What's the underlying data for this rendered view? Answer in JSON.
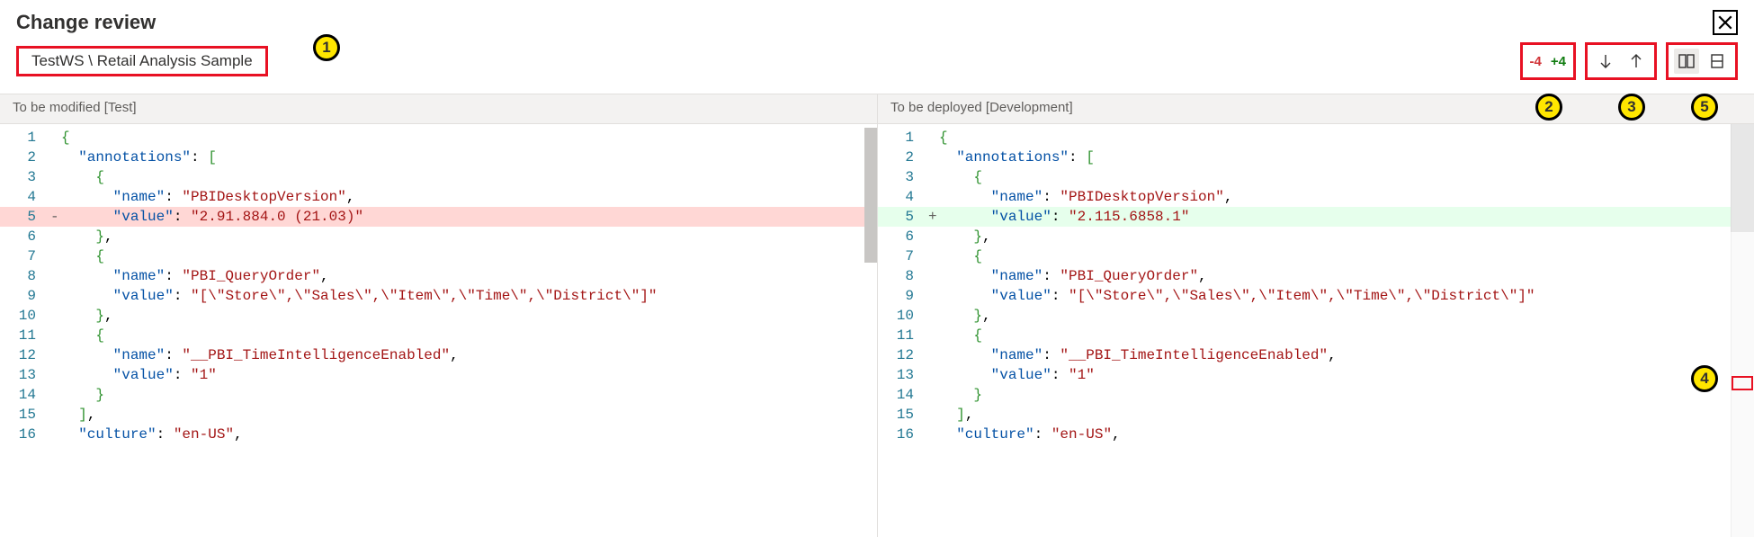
{
  "title": "Change review",
  "breadcrumb": "TestWS \\ Retail Analysis Sample",
  "diff": {
    "removed": "-4",
    "added": "+4"
  },
  "callouts": {
    "c1": "1",
    "c2": "2",
    "c3": "3",
    "c4": "4",
    "c5": "5"
  },
  "panes": {
    "left_header": "To be modified [Test]",
    "right_header": "To be deployed [Development]"
  },
  "left_lines": [
    {
      "n": "1",
      "sign": "",
      "cls": "",
      "tokens": [
        {
          "t": "top",
          "v": "{"
        }
      ]
    },
    {
      "n": "2",
      "sign": "",
      "cls": "",
      "tokens": [
        {
          "t": "sp",
          "v": "  "
        },
        {
          "t": "key",
          "v": "\"annotations\""
        },
        {
          "t": "punc",
          "v": ": "
        },
        {
          "t": "brace",
          "v": "["
        }
      ]
    },
    {
      "n": "3",
      "sign": "",
      "cls": "",
      "tokens": [
        {
          "t": "sp",
          "v": "    "
        },
        {
          "t": "brace",
          "v": "{"
        }
      ]
    },
    {
      "n": "4",
      "sign": "",
      "cls": "",
      "tokens": [
        {
          "t": "sp",
          "v": "      "
        },
        {
          "t": "key",
          "v": "\"name\""
        },
        {
          "t": "punc",
          "v": ": "
        },
        {
          "t": "str",
          "v": "\"PBIDesktopVersion\""
        },
        {
          "t": "comma",
          "v": ","
        }
      ]
    },
    {
      "n": "5",
      "sign": "-",
      "cls": "removed",
      "tokens": [
        {
          "t": "sp",
          "v": "      "
        },
        {
          "t": "key",
          "v": "\"value\""
        },
        {
          "t": "punc",
          "v": ": "
        },
        {
          "t": "str",
          "v": "\"2.91.884.0 (21.03)\""
        }
      ]
    },
    {
      "n": "6",
      "sign": "",
      "cls": "",
      "tokens": [
        {
          "t": "sp",
          "v": "    "
        },
        {
          "t": "brace",
          "v": "}"
        },
        {
          "t": "comma",
          "v": ","
        }
      ]
    },
    {
      "n": "7",
      "sign": "",
      "cls": "",
      "tokens": [
        {
          "t": "sp",
          "v": "    "
        },
        {
          "t": "brace",
          "v": "{"
        }
      ]
    },
    {
      "n": "8",
      "sign": "",
      "cls": "",
      "tokens": [
        {
          "t": "sp",
          "v": "      "
        },
        {
          "t": "key",
          "v": "\"name\""
        },
        {
          "t": "punc",
          "v": ": "
        },
        {
          "t": "str",
          "v": "\"PBI_QueryOrder\""
        },
        {
          "t": "comma",
          "v": ","
        }
      ]
    },
    {
      "n": "9",
      "sign": "",
      "cls": "",
      "tokens": [
        {
          "t": "sp",
          "v": "      "
        },
        {
          "t": "key",
          "v": "\"value\""
        },
        {
          "t": "punc",
          "v": ": "
        },
        {
          "t": "str",
          "v": "\"[\\\"Store\\\",\\\"Sales\\\",\\\"Item\\\",\\\"Time\\\",\\\"District\\\"]\""
        }
      ]
    },
    {
      "n": "10",
      "sign": "",
      "cls": "",
      "tokens": [
        {
          "t": "sp",
          "v": "    "
        },
        {
          "t": "brace",
          "v": "}"
        },
        {
          "t": "comma",
          "v": ","
        }
      ]
    },
    {
      "n": "11",
      "sign": "",
      "cls": "",
      "tokens": [
        {
          "t": "sp",
          "v": "    "
        },
        {
          "t": "brace",
          "v": "{"
        }
      ]
    },
    {
      "n": "12",
      "sign": "",
      "cls": "",
      "tokens": [
        {
          "t": "sp",
          "v": "      "
        },
        {
          "t": "key",
          "v": "\"name\""
        },
        {
          "t": "punc",
          "v": ": "
        },
        {
          "t": "str",
          "v": "\"__PBI_TimeIntelligenceEnabled\""
        },
        {
          "t": "comma",
          "v": ","
        }
      ]
    },
    {
      "n": "13",
      "sign": "",
      "cls": "",
      "tokens": [
        {
          "t": "sp",
          "v": "      "
        },
        {
          "t": "key",
          "v": "\"value\""
        },
        {
          "t": "punc",
          "v": ": "
        },
        {
          "t": "str",
          "v": "\"1\""
        }
      ]
    },
    {
      "n": "14",
      "sign": "",
      "cls": "",
      "tokens": [
        {
          "t": "sp",
          "v": "    "
        },
        {
          "t": "brace",
          "v": "}"
        }
      ]
    },
    {
      "n": "15",
      "sign": "",
      "cls": "",
      "tokens": [
        {
          "t": "sp",
          "v": "  "
        },
        {
          "t": "brace",
          "v": "]"
        },
        {
          "t": "comma",
          "v": ","
        }
      ]
    },
    {
      "n": "16",
      "sign": "",
      "cls": "",
      "tokens": [
        {
          "t": "sp",
          "v": "  "
        },
        {
          "t": "key",
          "v": "\"culture\""
        },
        {
          "t": "punc",
          "v": ": "
        },
        {
          "t": "str",
          "v": "\"en-US\""
        },
        {
          "t": "comma",
          "v": ","
        }
      ]
    }
  ],
  "right_lines": [
    {
      "n": "1",
      "sign": "",
      "cls": "",
      "tokens": [
        {
          "t": "top",
          "v": "{"
        }
      ]
    },
    {
      "n": "2",
      "sign": "",
      "cls": "",
      "tokens": [
        {
          "t": "sp",
          "v": "  "
        },
        {
          "t": "key",
          "v": "\"annotations\""
        },
        {
          "t": "punc",
          "v": ": "
        },
        {
          "t": "brace",
          "v": "["
        }
      ]
    },
    {
      "n": "3",
      "sign": "",
      "cls": "",
      "tokens": [
        {
          "t": "sp",
          "v": "    "
        },
        {
          "t": "brace",
          "v": "{"
        }
      ]
    },
    {
      "n": "4",
      "sign": "",
      "cls": "",
      "tokens": [
        {
          "t": "sp",
          "v": "      "
        },
        {
          "t": "key",
          "v": "\"name\""
        },
        {
          "t": "punc",
          "v": ": "
        },
        {
          "t": "str",
          "v": "\"PBIDesktopVersion\""
        },
        {
          "t": "comma",
          "v": ","
        }
      ]
    },
    {
      "n": "5",
      "sign": "+",
      "cls": "added",
      "tokens": [
        {
          "t": "sp",
          "v": "      "
        },
        {
          "t": "key",
          "v": "\"value\""
        },
        {
          "t": "punc",
          "v": ": "
        },
        {
          "t": "str",
          "v": "\"2.115.6858.1\""
        }
      ]
    },
    {
      "n": "6",
      "sign": "",
      "cls": "",
      "tokens": [
        {
          "t": "sp",
          "v": "    "
        },
        {
          "t": "brace",
          "v": "}"
        },
        {
          "t": "comma",
          "v": ","
        }
      ]
    },
    {
      "n": "7",
      "sign": "",
      "cls": "",
      "tokens": [
        {
          "t": "sp",
          "v": "    "
        },
        {
          "t": "brace",
          "v": "{"
        }
      ]
    },
    {
      "n": "8",
      "sign": "",
      "cls": "",
      "tokens": [
        {
          "t": "sp",
          "v": "      "
        },
        {
          "t": "key",
          "v": "\"name\""
        },
        {
          "t": "punc",
          "v": ": "
        },
        {
          "t": "str",
          "v": "\"PBI_QueryOrder\""
        },
        {
          "t": "comma",
          "v": ","
        }
      ]
    },
    {
      "n": "9",
      "sign": "",
      "cls": "",
      "tokens": [
        {
          "t": "sp",
          "v": "      "
        },
        {
          "t": "key",
          "v": "\"value\""
        },
        {
          "t": "punc",
          "v": ": "
        },
        {
          "t": "str",
          "v": "\"[\\\"Store\\\",\\\"Sales\\\",\\\"Item\\\",\\\"Time\\\",\\\"District\\\"]\""
        }
      ]
    },
    {
      "n": "10",
      "sign": "",
      "cls": "",
      "tokens": [
        {
          "t": "sp",
          "v": "    "
        },
        {
          "t": "brace",
          "v": "}"
        },
        {
          "t": "comma",
          "v": ","
        }
      ]
    },
    {
      "n": "11",
      "sign": "",
      "cls": "",
      "tokens": [
        {
          "t": "sp",
          "v": "    "
        },
        {
          "t": "brace",
          "v": "{"
        }
      ]
    },
    {
      "n": "12",
      "sign": "",
      "cls": "",
      "tokens": [
        {
          "t": "sp",
          "v": "      "
        },
        {
          "t": "key",
          "v": "\"name\""
        },
        {
          "t": "punc",
          "v": ": "
        },
        {
          "t": "str",
          "v": "\"__PBI_TimeIntelligenceEnabled\""
        },
        {
          "t": "comma",
          "v": ","
        }
      ]
    },
    {
      "n": "13",
      "sign": "",
      "cls": "",
      "tokens": [
        {
          "t": "sp",
          "v": "      "
        },
        {
          "t": "key",
          "v": "\"value\""
        },
        {
          "t": "punc",
          "v": ": "
        },
        {
          "t": "str",
          "v": "\"1\""
        }
      ]
    },
    {
      "n": "14",
      "sign": "",
      "cls": "",
      "tokens": [
        {
          "t": "sp",
          "v": "    "
        },
        {
          "t": "brace",
          "v": "}"
        }
      ]
    },
    {
      "n": "15",
      "sign": "",
      "cls": "",
      "tokens": [
        {
          "t": "sp",
          "v": "  "
        },
        {
          "t": "brace",
          "v": "]"
        },
        {
          "t": "comma",
          "v": ","
        }
      ]
    },
    {
      "n": "16",
      "sign": "",
      "cls": "",
      "tokens": [
        {
          "t": "sp",
          "v": "  "
        },
        {
          "t": "key",
          "v": "\"culture\""
        },
        {
          "t": "punc",
          "v": ": "
        },
        {
          "t": "str",
          "v": "\"en-US\""
        },
        {
          "t": "comma",
          "v": ","
        }
      ]
    }
  ]
}
